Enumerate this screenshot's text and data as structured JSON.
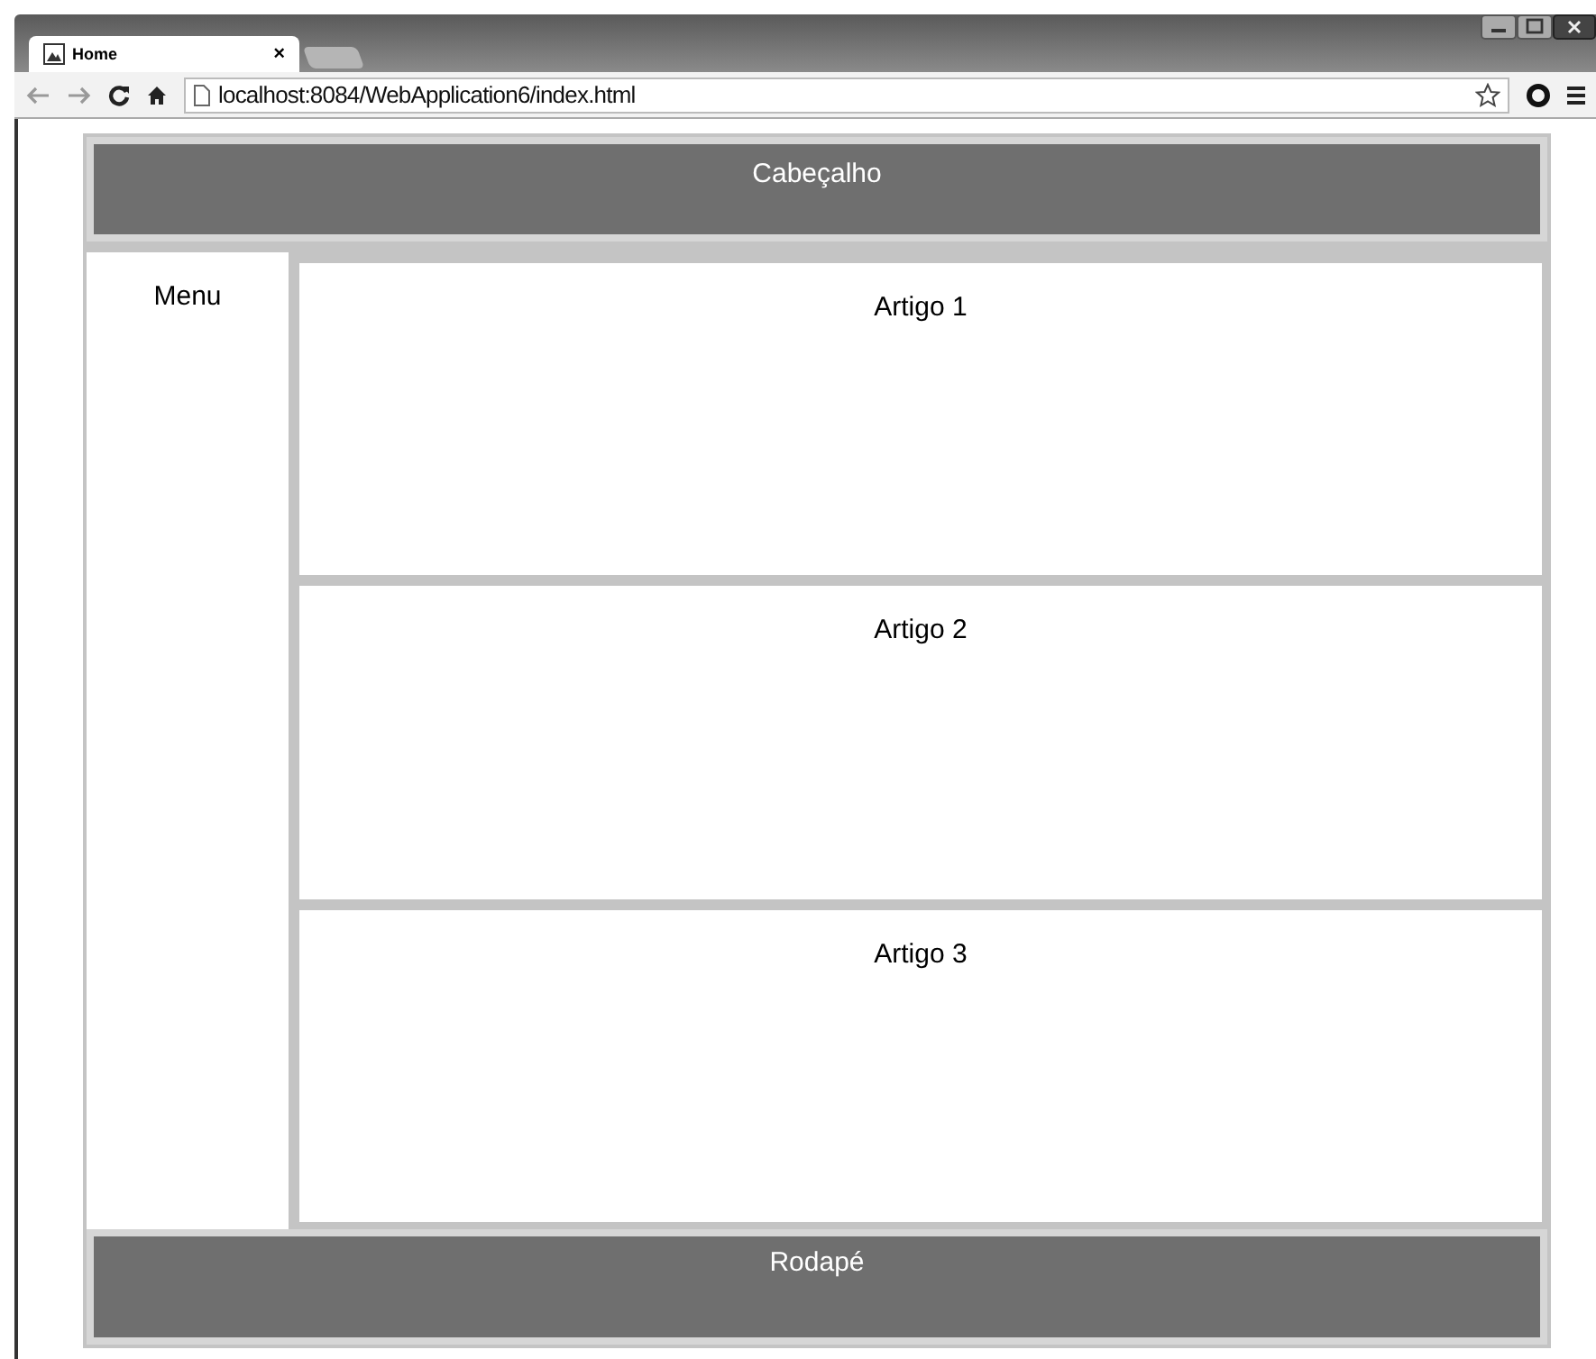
{
  "browser": {
    "tab": {
      "title": "Home",
      "close": "×"
    },
    "url": "localhost:8084/WebApplication6/index.html"
  },
  "page": {
    "header": "Cabeçalho",
    "menu": "Menu",
    "articles": [
      {
        "title": "Artigo 1"
      },
      {
        "title": "Artigo 2"
      },
      {
        "title": "Artigo 3"
      }
    ],
    "footer": "Rodapé"
  }
}
